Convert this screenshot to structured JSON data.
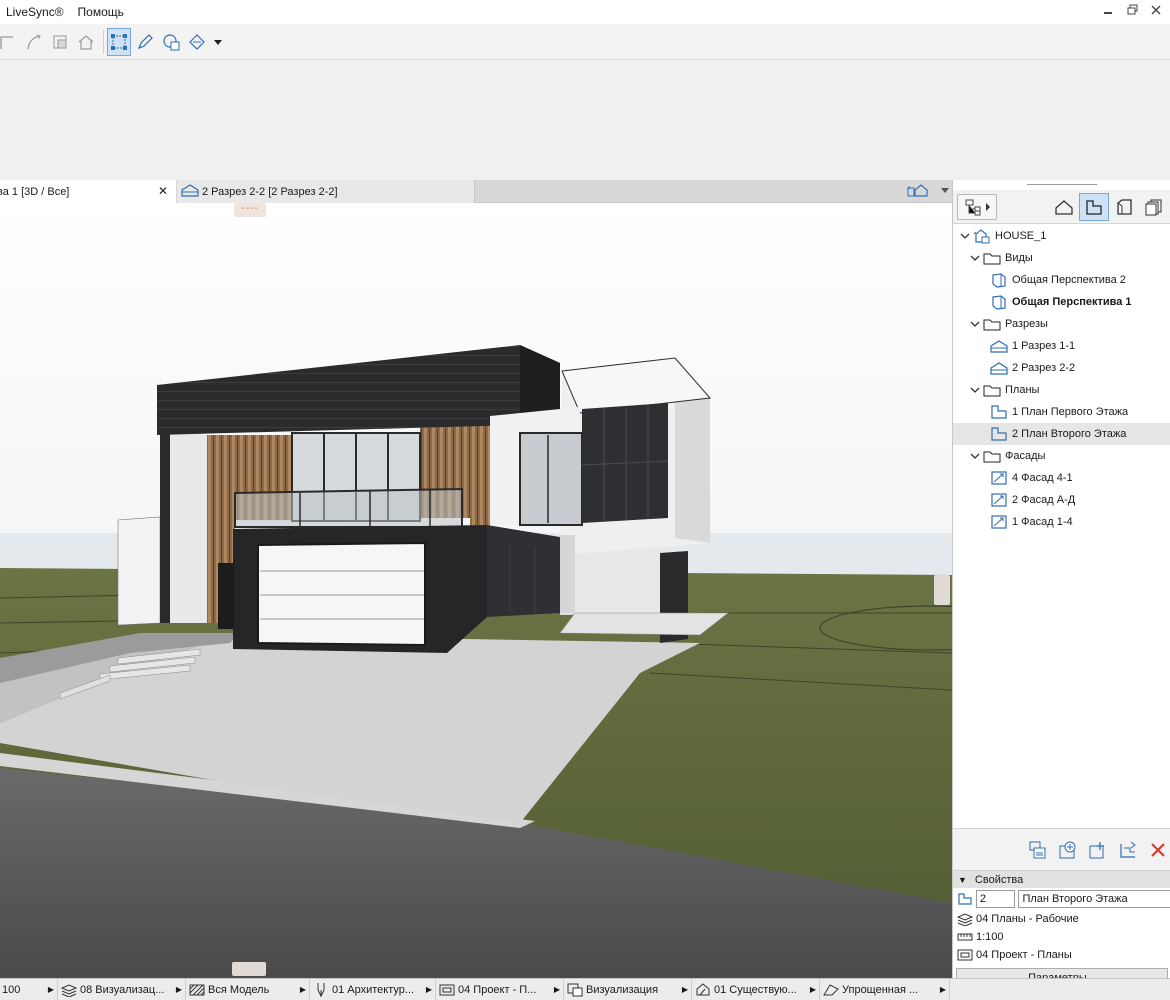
{
  "menu": {
    "items": [
      "LiveSync®",
      "Помощь"
    ]
  },
  "window_controls": {
    "minimize": "▬",
    "restore": "❐",
    "close": "✕"
  },
  "toolbar": {
    "buttons": [
      "line-tool-icon",
      "arc-tool-icon",
      "resize-tool-icon",
      "house-icon",
      "selection-box-icon",
      "pen-tool-icon",
      "layer-stack-icon",
      "fill-tool-icon",
      "dropdown-arrow-icon"
    ]
  },
  "tabs": [
    {
      "label": "ва 1 [3D / Все]",
      "close": "✕",
      "active": true
    },
    {
      "label": "2 Разрез 2-2 [2 Разрез 2-2]",
      "active": false
    }
  ],
  "tab_marker": "----",
  "navigator": {
    "tree": [
      {
        "label": "HOUSE_1",
        "level": 0,
        "icon": "project-icon",
        "expanded": true
      },
      {
        "label": "Виды",
        "level": 1,
        "icon": "folder-icon",
        "expanded": true
      },
      {
        "label": "Общая Перспектива 2",
        "level": 2,
        "icon": "3d-view-icon"
      },
      {
        "label": "Общая Перспектива 1",
        "level": 2,
        "icon": "3d-view-icon",
        "bold": true
      },
      {
        "label": "Разрезы",
        "level": 1,
        "icon": "folder-icon",
        "expanded": true
      },
      {
        "label": "1 Разрез 1-1",
        "level": 2,
        "icon": "section-icon"
      },
      {
        "label": "2 Разрез 2-2",
        "level": 2,
        "icon": "section-icon"
      },
      {
        "label": "Планы",
        "level": 1,
        "icon": "folder-icon",
        "expanded": true
      },
      {
        "label": "1 План Первого Этажа",
        "level": 2,
        "icon": "floor-plan-icon"
      },
      {
        "label": "2 План Второго Этажа",
        "level": 2,
        "icon": "floor-plan-icon",
        "selected": true
      },
      {
        "label": "Фасады",
        "level": 1,
        "icon": "folder-icon",
        "expanded": true
      },
      {
        "label": "4 Фасад 4-1",
        "level": 2,
        "icon": "elevation-icon"
      },
      {
        "label": "2 Фасад А-Д",
        "level": 2,
        "icon": "elevation-icon"
      },
      {
        "label": "1 Фасад 1-4",
        "level": 2,
        "icon": "elevation-icon"
      }
    ]
  },
  "properties": {
    "title": "Свойства",
    "id_value": "2",
    "name_value": "План Второго Этажа",
    "layer_combo": "04 Планы - Рабочие",
    "scale": "1:100",
    "view_set": "04 Проект - Планы",
    "params_button": "Параметры..."
  },
  "statusbar": {
    "items": [
      {
        "label": "100",
        "icon": ""
      },
      {
        "label": "08 Визуализац...",
        "icon": "layers-icon"
      },
      {
        "label": "Вся Модель",
        "icon": "hatch-icon"
      },
      {
        "label": "01 Архитектур...",
        "icon": "pen-set-icon"
      },
      {
        "label": "04 Проект - П...",
        "icon": "model-view-icon"
      },
      {
        "label": "Визуализация",
        "icon": "graphic-override-icon"
      },
      {
        "label": "01 Существую...",
        "icon": "renovation-icon"
      },
      {
        "label": "Упрощенная ...",
        "icon": "structure-icon"
      }
    ]
  },
  "colors": {
    "accent": "#2f6fb5",
    "selection": "#cfe1f4",
    "delete": "#d9342b",
    "grass": "#5d6b3b",
    "asphalt": "#5a5a5a",
    "concrete": "#cfcfcf"
  }
}
